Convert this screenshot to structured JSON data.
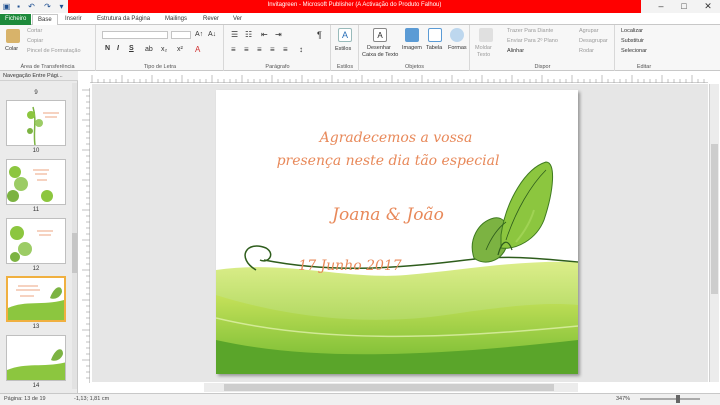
{
  "window": {
    "title": "Invitagreen  -  Microsoft Publisher (A Activação do Produto Falhou)"
  },
  "tabs": [
    "Ficheiro",
    "Base",
    "Inserir",
    "Estrutura da Página",
    "Mailings",
    "Rever",
    "Ver"
  ],
  "active_tab": "Base",
  "ribbon": {
    "clipboard": {
      "label": "Área de Transferência",
      "paste": "Colar",
      "cut": "Cortar",
      "copy": "Copiar",
      "format_painter": "Pincel de Formatação"
    },
    "font": {
      "label": "Tipo de Letra",
      "bold": "N",
      "italic": "I",
      "underline": "S"
    },
    "paragraph": {
      "label": "Parágrafo"
    },
    "styles": {
      "label": "Estilos",
      "button": "Estilos"
    },
    "objects": {
      "label": "Objetos",
      "draw_textbox_1": "Desenhar",
      "draw_textbox_2": "Caixa de Texto",
      "picture": "Imagem",
      "table": "Tabela",
      "shapes": "Formas"
    },
    "arrange": {
      "label": "Dispor",
      "wrap_1": "Moldar",
      "wrap_2": "Texto",
      "bring_forward": "Trazer Para Diante",
      "send_backward": "Enviar Para 2º Plano",
      "align": "Alinhar",
      "group": "Agrupar",
      "ungroup": "Desagrupar",
      "rotate": "Rodar"
    },
    "editing": {
      "label": "Editar",
      "find": "Localizar",
      "replace": "Substituir",
      "select": "Selecionar"
    }
  },
  "nav_pane": {
    "title": "Navegação Entre Pági...",
    "pages": [
      "9",
      "10",
      "11",
      "12",
      "13",
      "14"
    ],
    "selected_page": "13"
  },
  "page_content": {
    "line1": "Agradecemos a vossa",
    "line2": "presença neste dia tão especial",
    "names": "Joana & João",
    "date": "17 Junho 2017"
  },
  "status": {
    "page": "Página: 13 de 19",
    "position": "-1,13; 1,81 cm",
    "zoom": "347%"
  },
  "colors": {
    "accent_green": "#1d8a3b",
    "title_red": "#ff0000",
    "script_orange": "#e8895a",
    "leaf_green": "#8cc63f"
  }
}
